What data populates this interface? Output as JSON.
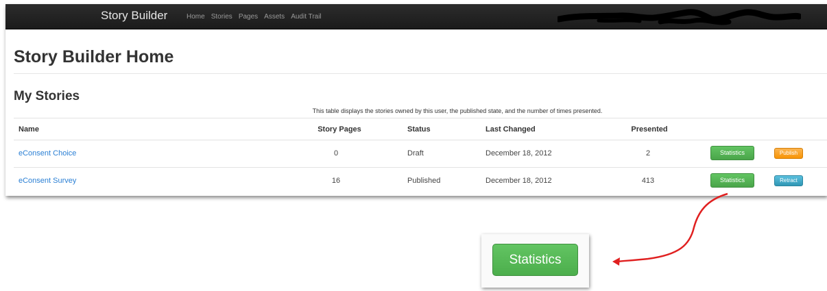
{
  "navbar": {
    "brand": "Story Builder",
    "links": [
      "Home",
      "Stories",
      "Pages",
      "Assets",
      "Audit Trail"
    ]
  },
  "page": {
    "title": "Story Builder Home",
    "section_title": "My Stories",
    "caption": "This table displays the stories owned by this user, the published state, and the number of times presented."
  },
  "table": {
    "headers": [
      "Name",
      "Story Pages",
      "Status",
      "Last Changed",
      "Presented"
    ],
    "rows": [
      {
        "name": "eConsent Choice",
        "pages": "0",
        "status": "Draft",
        "changed": "December 18, 2012",
        "presented": "2",
        "stats_label": "Statistics",
        "action_label": "Publish"
      },
      {
        "name": "eConsent Survey",
        "pages": "16",
        "status": "Published",
        "changed": "December 18, 2012",
        "presented": "413",
        "stats_label": "Statistics",
        "action_label": "Retract"
      }
    ]
  },
  "callout": {
    "button_label": "Statistics",
    "arrow_color": "#e02020"
  }
}
